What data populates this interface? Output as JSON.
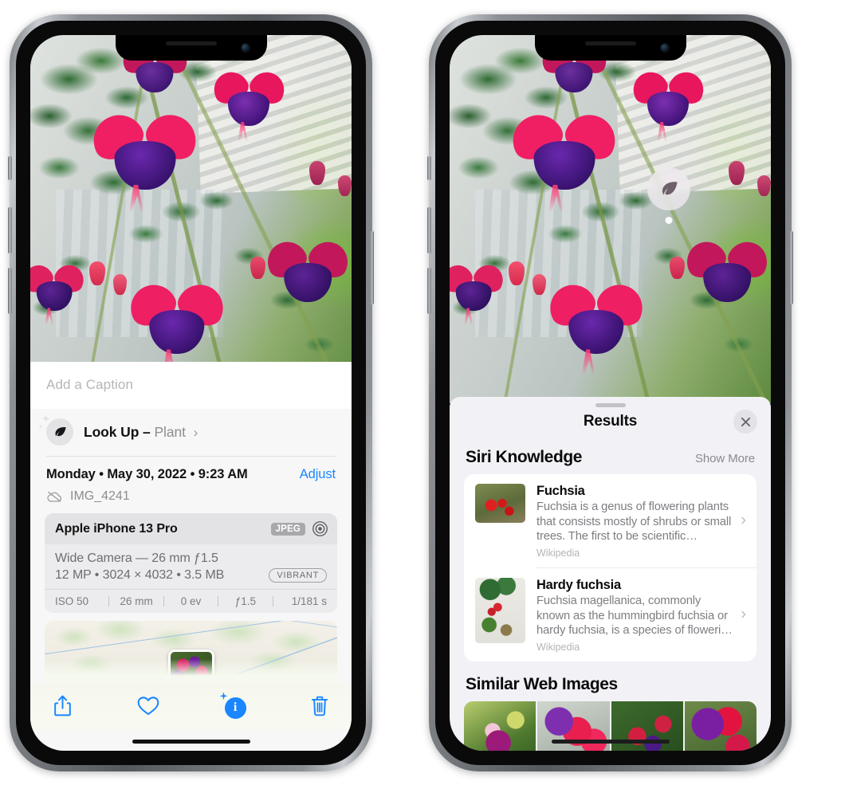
{
  "left_phone": {
    "caption_placeholder": "Add a Caption",
    "lookup": {
      "label": "Look Up –",
      "subject": "Plant",
      "chevron": "›",
      "icon": "leaf-icon"
    },
    "date_line": "Monday • May 30, 2022 • 9:23 AM",
    "adjust_label": "Adjust",
    "filename": "IMG_4241",
    "metadata": {
      "device": "Apple iPhone 13 Pro",
      "format_badge": "JPEG",
      "lens": "Wide Camera — 26 mm ƒ1.5",
      "size_line": "12 MP • 3024 × 4032 • 3.5 MB",
      "style_badge": "VIBRANT",
      "exif": [
        "ISO 50",
        "26 mm",
        "0 ev",
        "ƒ1.5",
        "1/181 s"
      ]
    },
    "toolbar": {
      "share_label": "share-icon",
      "favorite_label": "heart-icon",
      "info_label": "info-icon",
      "delete_label": "trash-icon",
      "info_glyph": "i"
    }
  },
  "right_phone": {
    "vlu_badge_icon": "leaf-icon",
    "sheet": {
      "title": "Results",
      "close_label": "✕",
      "sections": [
        {
          "title": "Siri Knowledge",
          "action": "Show More",
          "items": [
            {
              "title": "Fuchsia",
              "description": "Fuchsia is a genus of flowering plants that consists mostly of shrubs or small trees. The first to be scientific…",
              "source": "Wikipedia",
              "chevron": "›"
            },
            {
              "title": "Hardy fuchsia",
              "description": "Fuchsia magellanica, commonly known as the hummingbird fuchsia or hardy fuchsia, is a species of floweri…",
              "source": "Wikipedia",
              "chevron": "›"
            }
          ]
        },
        {
          "title": "Similar Web Images",
          "thumbnails": [
            "fuchsia-web-image-1",
            "fuchsia-web-image-2",
            "fuchsia-web-image-3",
            "fuchsia-web-image-4"
          ]
        }
      ]
    }
  },
  "colors": {
    "accent_blue": "#1a86ff",
    "sheet_bg": "#f2f2f6",
    "panel_bg": "#f7f7f7",
    "card_bg": "#ffffff",
    "secondary_text": "#8a8a8f"
  }
}
